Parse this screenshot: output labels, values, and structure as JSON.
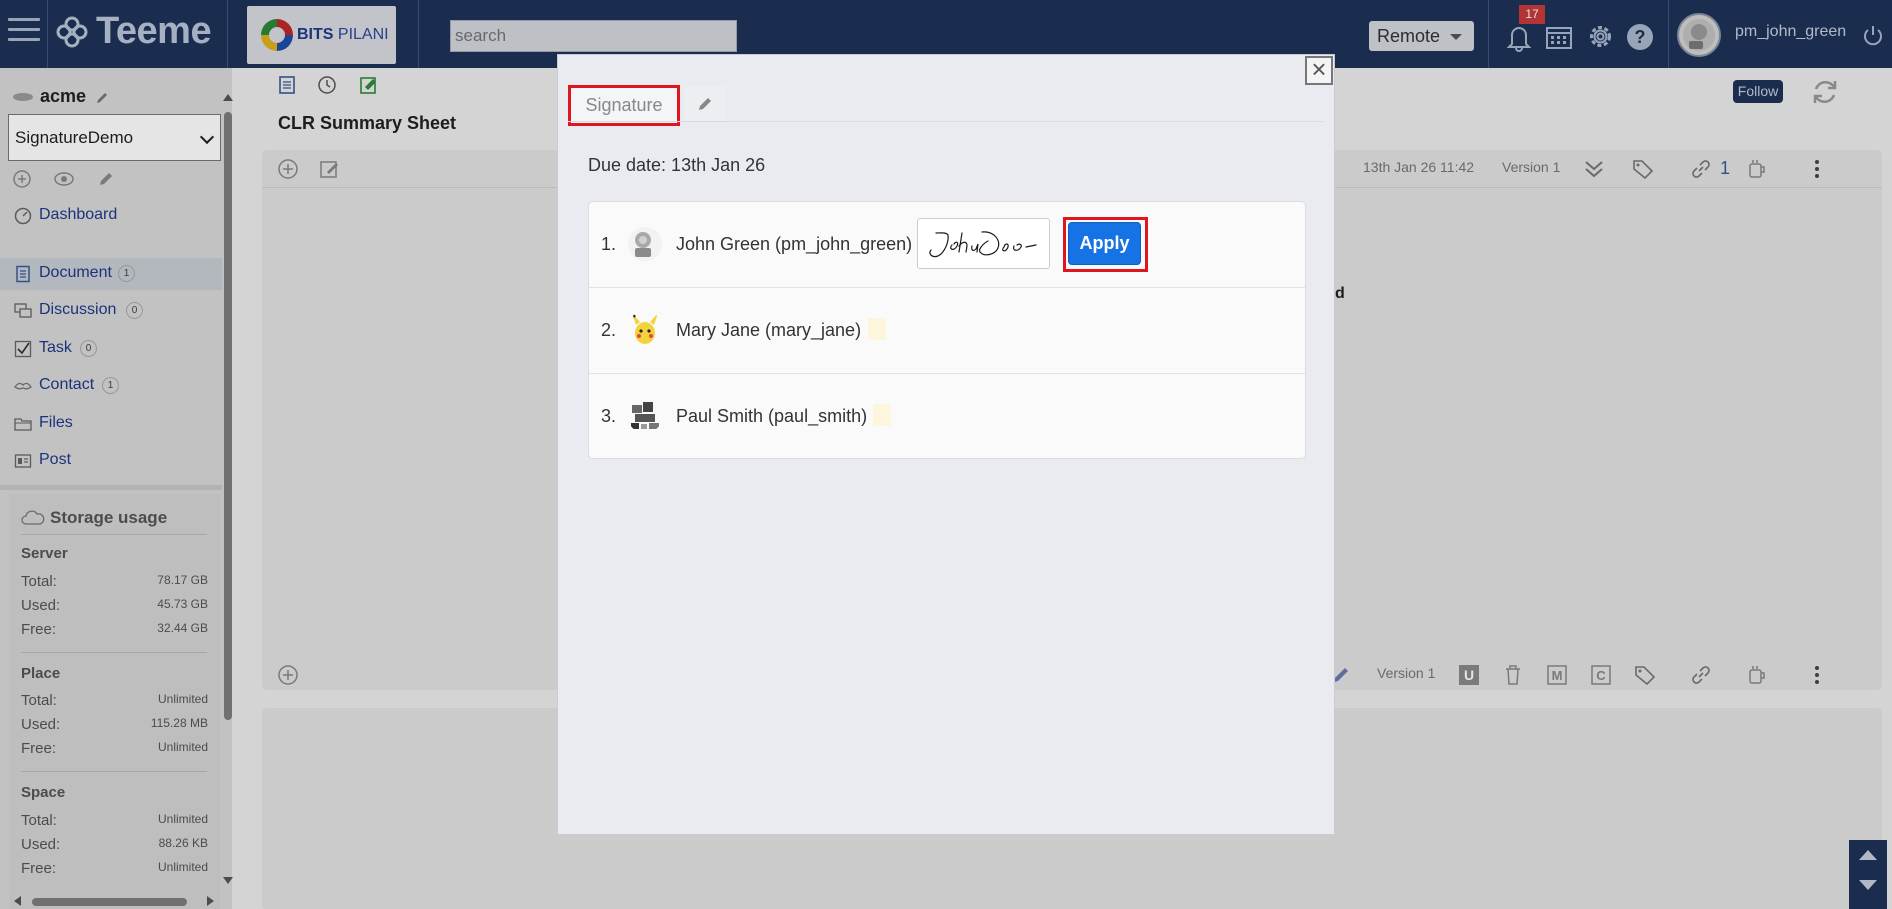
{
  "app": {
    "logo_text": "Teeme",
    "org_logo": {
      "name_bold": "BITS",
      "name_rest": " PILANI"
    },
    "search_placeholder": "search",
    "mode_dropdown": "Remote",
    "notification_count": "17",
    "help_label": "?",
    "user": "pm_john_green"
  },
  "sidebar": {
    "workspace": "acme",
    "selected_space": "SignatureDemo",
    "nav": [
      {
        "label": "Dashboard",
        "icon": "dashboard-icon"
      },
      {
        "label": "Document",
        "icon": "document-icon",
        "count": "1"
      },
      {
        "label": "Discussion",
        "icon": "discussion-icon",
        "count": "0"
      },
      {
        "label": "Task",
        "icon": "task-checkbox-icon",
        "count": "0"
      },
      {
        "label": "Contact",
        "icon": "contact-icon",
        "count": "1"
      },
      {
        "label": "Files",
        "icon": "folder-icon"
      },
      {
        "label": "Post",
        "icon": "post-icon"
      }
    ],
    "storage": {
      "title": "Storage usage",
      "groups": [
        {
          "name": "Server",
          "total": "78.17 GB",
          "used": "45.73 GB",
          "free": "32.44 GB"
        },
        {
          "name": "Place",
          "total": "Unlimited",
          "used": "115.28 MB",
          "free": "Unlimited"
        },
        {
          "name": "Space",
          "total": "Unlimited",
          "used": "88.26 KB",
          "free": "Unlimited"
        }
      ],
      "labels": {
        "total": "Total:",
        "used": "Used:",
        "free": "Free:"
      }
    }
  },
  "document": {
    "title": "CLR Summary Sheet",
    "follow_label": "Follow",
    "date": "13th Jan 26 11:42",
    "version": "Version 1",
    "links_count": "1",
    "footer_version": "Version 1",
    "partial_text": "d"
  },
  "modal": {
    "tab_label": "Signature",
    "close_label": "×",
    "due_date": "Due date: 13th Jan 26",
    "signers": [
      {
        "num": "1.",
        "name": "John Green (pm_john_green)",
        "signed": true
      },
      {
        "num": "2.",
        "name": "Mary Jane (mary_jane)",
        "signed": false
      },
      {
        "num": "3.",
        "name": "Paul Smith (paul_smith)",
        "signed": false
      }
    ],
    "apply_label": "Apply",
    "highlight_color": "#e0161e",
    "primary_color": "#1673e6"
  }
}
